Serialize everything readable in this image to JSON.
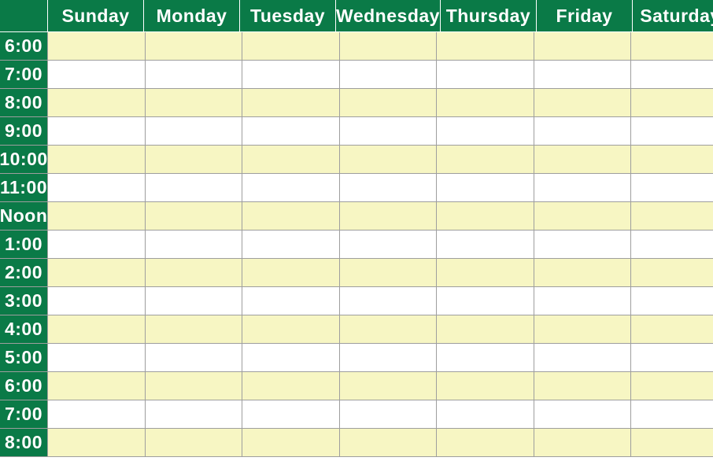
{
  "schedule": {
    "corner": "",
    "days": [
      "Sunday",
      "Monday",
      "Tuesday",
      "Wednesday",
      "Thursday",
      "Friday",
      "Saturday"
    ],
    "times": [
      "6:00",
      "7:00",
      "8:00",
      "9:00",
      "10:00",
      "11:00",
      "Noon",
      "1:00",
      "2:00",
      "3:00",
      "4:00",
      "5:00",
      "6:00",
      "7:00",
      "8:00"
    ],
    "colors": {
      "header_bg": "#0a7a47",
      "header_text": "#ffffff",
      "alt_row_bg": "#f7f6c3",
      "row_bg": "#ffffff",
      "border": "#9e9e9e"
    }
  }
}
